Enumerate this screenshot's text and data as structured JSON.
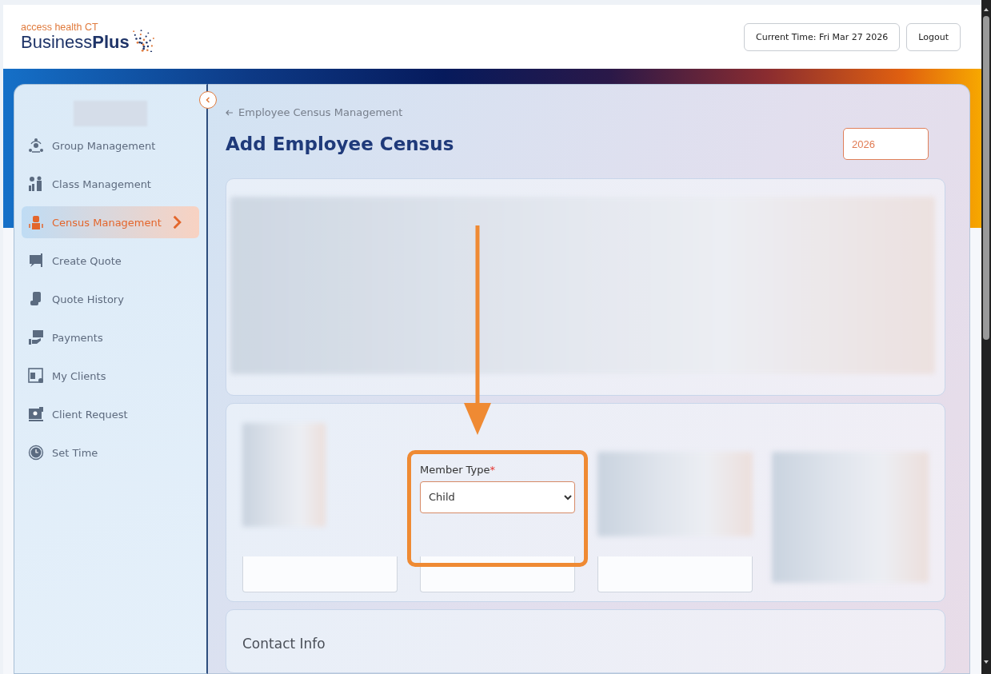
{
  "header": {
    "logo": {
      "tagline": "access health CT",
      "brand": "Business**Plus**"
    },
    "current_time": "Current Time: Fri Mar 27 2026",
    "logout": "Logout"
  },
  "sidebar": {
    "items": [
      {
        "label": "Group Management",
        "selected": false
      },
      {
        "label": "Class Management",
        "selected": false
      },
      {
        "label": "Census Management",
        "selected": true
      },
      {
        "label": "Create Quote",
        "selected": false
      },
      {
        "label": "Quote History",
        "selected": false
      },
      {
        "label": "Payments",
        "selected": false
      },
      {
        "label": "My Clients",
        "selected": false
      },
      {
        "label": "Client Request",
        "selected": false
      },
      {
        "label": "Set Time",
        "selected": false
      }
    ]
  },
  "breadcrumb": {
    "label": "Employee Census Management"
  },
  "title": "Add Employee Census",
  "year_field": {
    "value": "2026"
  },
  "member_type": {
    "label": "Member Type",
    "required_mark": "*",
    "value": "Child"
  },
  "contact_section": {
    "title": "Contact Info"
  }
}
